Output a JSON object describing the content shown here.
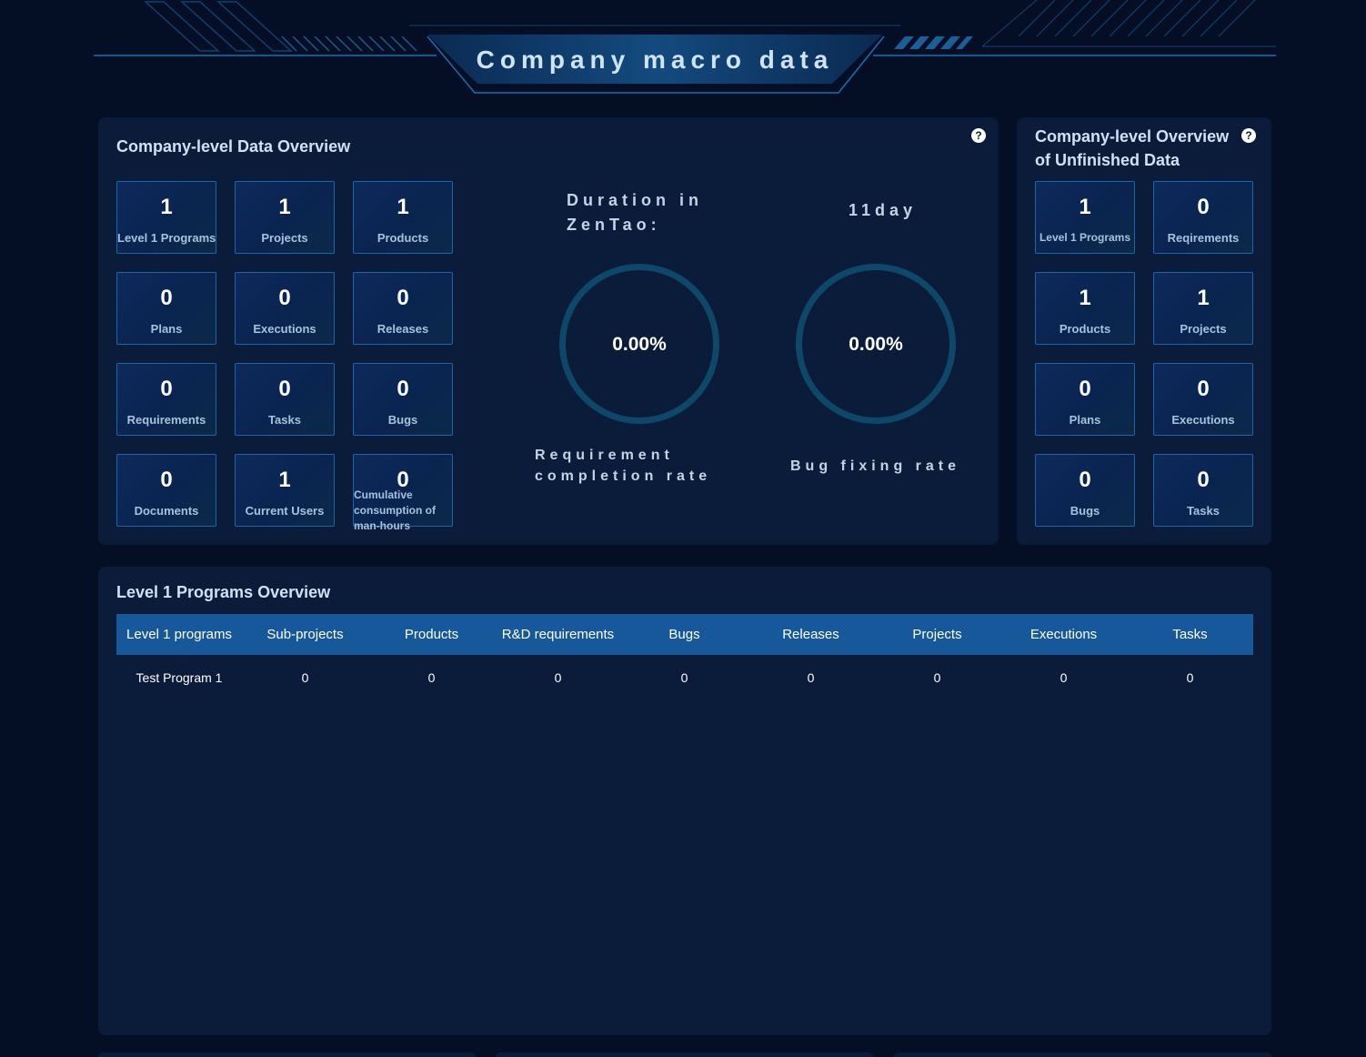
{
  "page": {
    "title": "Company macro data"
  },
  "overview": {
    "title": "Company-level Data Overview",
    "help": "?",
    "stats": [
      {
        "value": "1",
        "label": "Level 1 Programs"
      },
      {
        "value": "1",
        "label": "Projects"
      },
      {
        "value": "1",
        "label": "Products"
      },
      {
        "value": "0",
        "label": "Plans"
      },
      {
        "value": "0",
        "label": "Executions"
      },
      {
        "value": "0",
        "label": "Releases"
      },
      {
        "value": "0",
        "label": "Requirements"
      },
      {
        "value": "0",
        "label": "Tasks"
      },
      {
        "value": "0",
        "label": "Bugs"
      },
      {
        "value": "0",
        "label": "Documents"
      },
      {
        "value": "1",
        "label": "Current Users"
      },
      {
        "value": "0",
        "label": "Cumulative consumption of man-hours"
      }
    ],
    "duration_label": "Duration in ZenTao:",
    "duration_value": "11day",
    "requirement_rate": {
      "value": "0.00%",
      "label": "Requirement completion rate",
      "fraction": 0
    },
    "bug_rate": {
      "value": "0.00%",
      "label": "Bug fixing rate",
      "fraction": 0
    }
  },
  "unfinished": {
    "title": "Company-level Overview of Unfinished Data",
    "help": "?",
    "stats": [
      {
        "value": "1",
        "label": "Level 1 Programs"
      },
      {
        "value": "0",
        "label": "Reqirements"
      },
      {
        "value": "1",
        "label": "Products"
      },
      {
        "value": "1",
        "label": "Projects"
      },
      {
        "value": "0",
        "label": "Plans"
      },
      {
        "value": "0",
        "label": "Executions"
      },
      {
        "value": "0",
        "label": "Bugs"
      },
      {
        "value": "0",
        "label": "Tasks"
      }
    ]
  },
  "programs": {
    "title": "Level 1 Programs Overview",
    "columns": [
      "Level 1 programs",
      "Sub-projects",
      "Products",
      "R&D requirements",
      "Bugs",
      "Releases",
      "Projects",
      "Executions",
      "Tasks"
    ],
    "rows": [
      [
        "Test Program 1",
        "0",
        "0",
        "0",
        "0",
        "0",
        "0",
        "0",
        "0"
      ]
    ]
  },
  "colors": {
    "background": "#040f26",
    "panel": "#0b1c3a",
    "table_header": "#17589a",
    "ring": "#0e4869",
    "card_border": "#1e64a8"
  }
}
